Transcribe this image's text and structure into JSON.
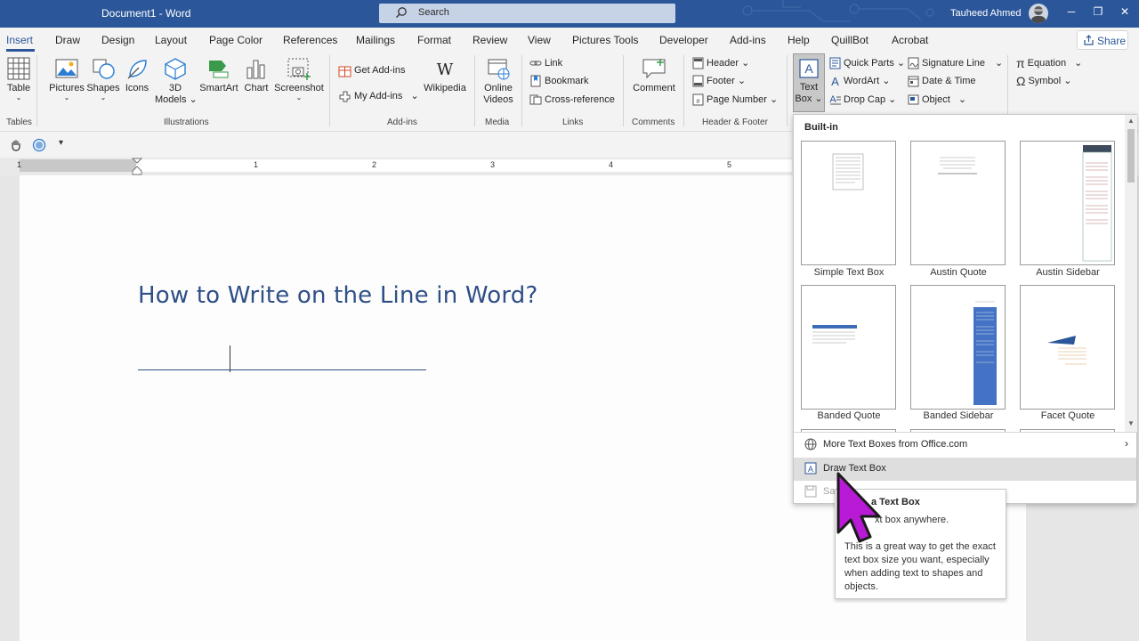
{
  "window": {
    "doc_title": "Document1  -  Word",
    "search_placeholder": "Search",
    "user_name": "Tauheed Ahmed",
    "minimize": "─",
    "restore": "❐",
    "close": "✕"
  },
  "tabs": [
    "Insert",
    "Draw",
    "Design",
    "Layout",
    "Page Color",
    "References",
    "Mailings",
    "Format",
    "Review",
    "View",
    "Pictures Tools",
    "Developer",
    "Add-ins",
    "Help",
    "QuillBot",
    "Acrobat"
  ],
  "share_label": "Share",
  "ribbon": {
    "tables": {
      "table": "Table",
      "group": "Tables"
    },
    "illustrations": {
      "pictures": "Pictures",
      "shapes": "Shapes",
      "icons": "Icons",
      "models_line1": "3D",
      "models_line2": "Models",
      "smartart": "SmartArt",
      "chart": "Chart",
      "screenshot": "Screenshot",
      "group": "Illustrations"
    },
    "addins": {
      "get": "Get Add-ins",
      "my": "My Add-ins",
      "wikipedia": "Wikipedia",
      "group": "Add-ins"
    },
    "media": {
      "online_line1": "Online",
      "online_line2": "Videos",
      "group": "Media"
    },
    "links": {
      "link": "Link",
      "bookmark": "Bookmark",
      "crossref": "Cross-reference",
      "group": "Links"
    },
    "comments": {
      "comment": "Comment",
      "group": "Comments"
    },
    "header_footer": {
      "header": "Header",
      "footer": "Footer",
      "page_number": "Page Number",
      "group": "Header & Footer"
    },
    "text": {
      "textbox_line1": "Text",
      "textbox_line2": "Box",
      "quick_parts": "Quick Parts",
      "wordart": "WordArt",
      "drop_cap": "Drop Cap",
      "signature_line": "Signature Line",
      "date_time": "Date & Time",
      "object": "Object"
    },
    "symbols": {
      "equation": "Equation",
      "symbol": "Symbol"
    }
  },
  "ruler": {
    "numbers": [
      "1",
      "1",
      "2",
      "3",
      "4",
      "5"
    ]
  },
  "document": {
    "heading": "How to Write on the Line in Word?"
  },
  "gallery": {
    "section": "Built-in",
    "items": [
      "Simple Text Box",
      "Austin Quote",
      "Austin Sidebar",
      "Banded Quote",
      "Banded Sidebar",
      "Facet Quote"
    ],
    "more": "More Text Boxes from Office.com",
    "draw": "Draw Text Box",
    "save": "Sa"
  },
  "tooltip": {
    "title": "a Text Box",
    "line1": "xt box anywhere.",
    "body": "This is a great way to get the exact text box size you want, especially when adding text to shapes and objects."
  },
  "colors": {
    "title_bar": "#2b579a",
    "accent": "#2b579a",
    "heading": "#2f4f86",
    "pointer": "#b81ad6"
  }
}
